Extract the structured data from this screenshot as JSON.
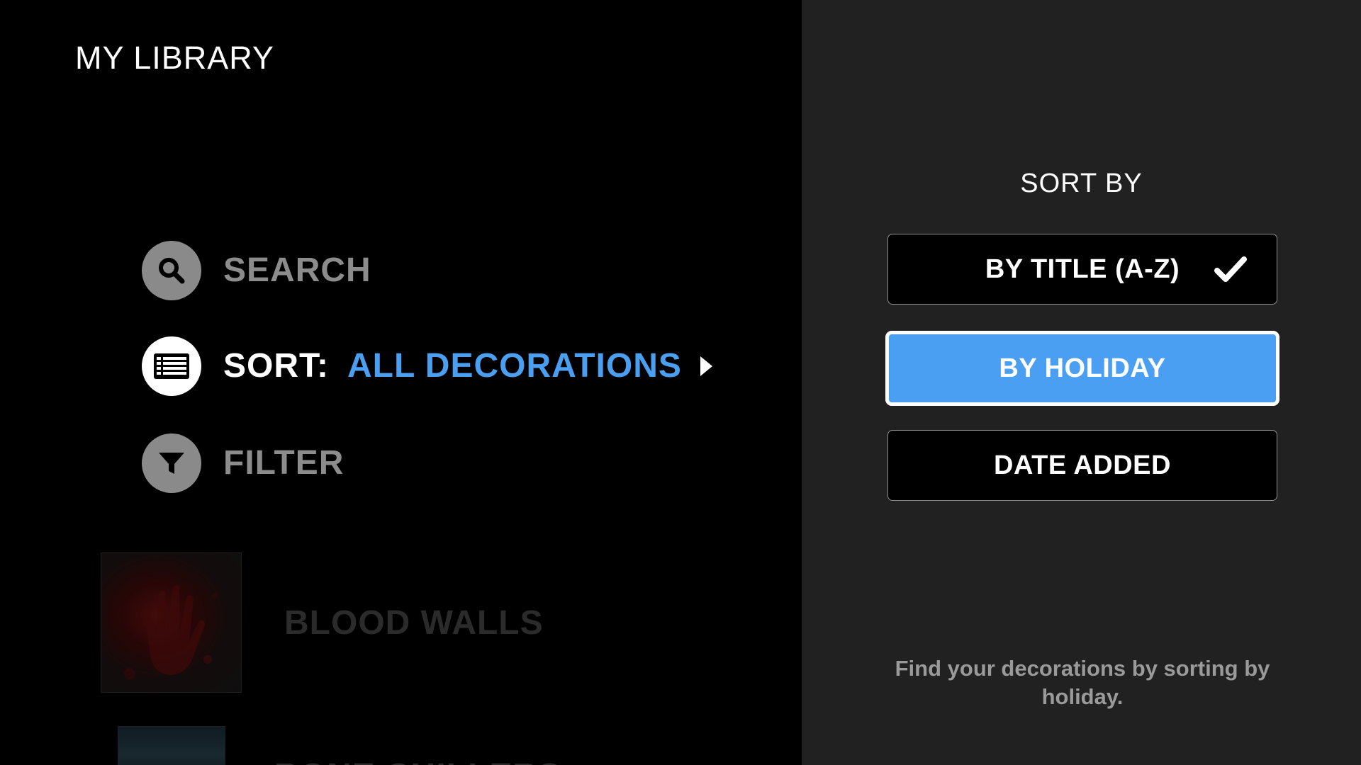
{
  "header": {
    "title": "MY LIBRARY"
  },
  "menu": {
    "search": {
      "label": "SEARCH",
      "icon": "search-icon"
    },
    "sort": {
      "label": "SORT:",
      "value": "ALL DECORATIONS",
      "icon": "list-icon"
    },
    "filter": {
      "label": "FILTER",
      "icon": "funnel-icon"
    }
  },
  "library": {
    "items": [
      {
        "title": "BLOOD WALLS"
      },
      {
        "title": "BONE CHILLERS"
      }
    ]
  },
  "sort_panel": {
    "heading": "SORT BY",
    "options": [
      {
        "label": "BY TITLE (A-Z)",
        "checked": true
      },
      {
        "label": "BY HOLIDAY",
        "focused": true
      },
      {
        "label": "DATE ADDED"
      }
    ],
    "hint": "Find your decorations by sorting by holiday."
  },
  "colors": {
    "accent": "#4b9ff2",
    "panel_bg": "#212121",
    "background": "#000000"
  }
}
